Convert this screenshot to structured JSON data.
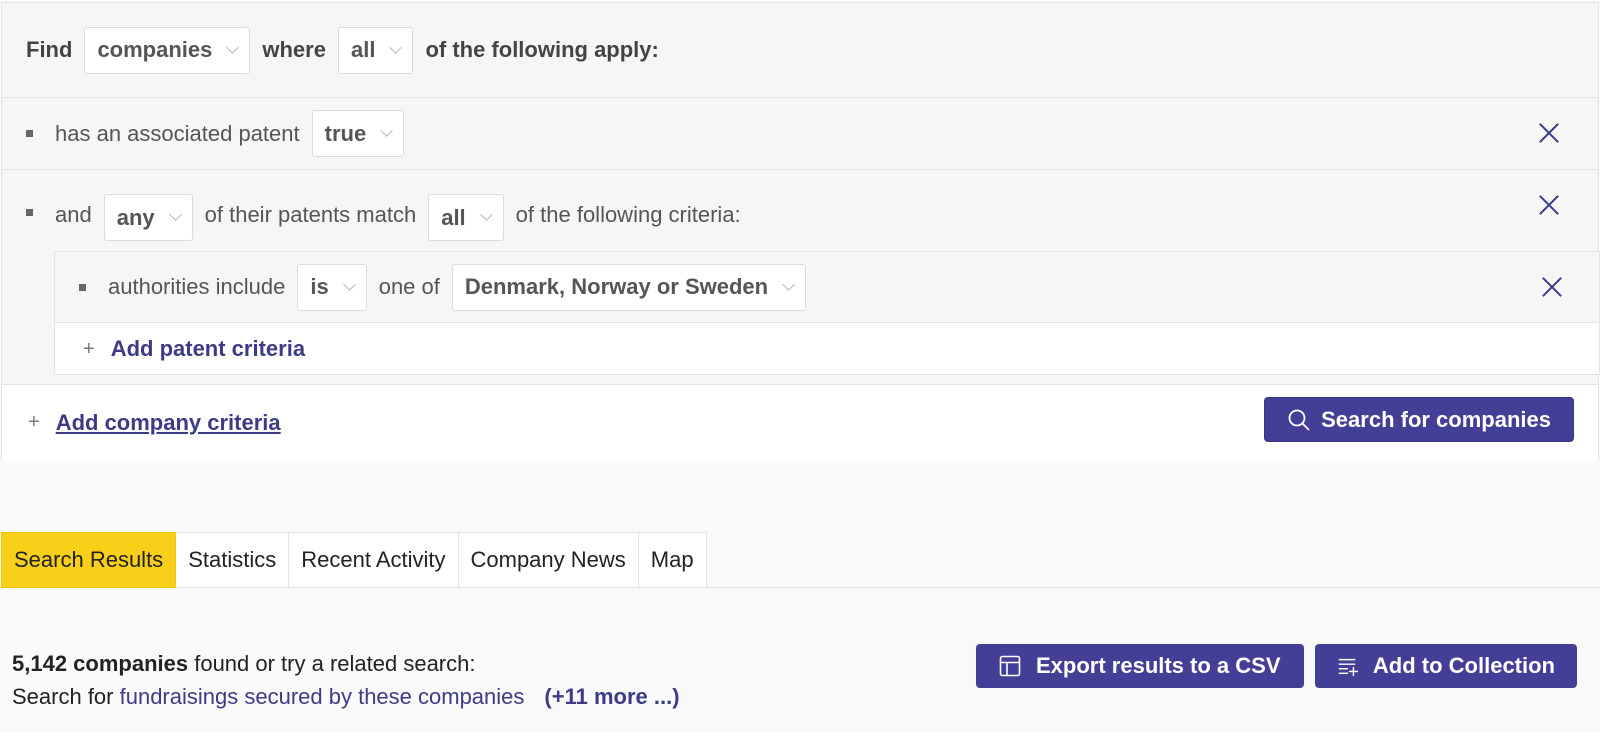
{
  "query": {
    "find_label": "Find",
    "entity_select": "companies",
    "where_label": "where",
    "match_select": "all",
    "apply_text": "of the following apply:"
  },
  "criteria": [
    {
      "label": "has an associated patent",
      "value": "true"
    },
    {
      "and_label": "and",
      "quantifier": "any",
      "middle_text": "of their patents match",
      "match_select": "all",
      "end_text": "of the following criteria:",
      "nested": {
        "label": "authorities include",
        "operator": "is",
        "one_of_label": "one of",
        "values": "Denmark, Norway or Sweden",
        "add_label": "Add patent criteria"
      }
    }
  ],
  "footer": {
    "add_company_label": "Add company criteria",
    "search_button": "Search for companies"
  },
  "tabs": [
    {
      "label": "Search Results",
      "active": true
    },
    {
      "label": "Statistics",
      "active": false
    },
    {
      "label": "Recent Activity",
      "active": false
    },
    {
      "label": "Company News",
      "active": false
    },
    {
      "label": "Map",
      "active": false
    }
  ],
  "results": {
    "count": "5,142 companies",
    "found_text": " found or try a related search:",
    "search_for": "Search for ",
    "related_link": "fundraisings secured by these companies",
    "more_link": "(+11 more ...)",
    "export_button": "Export results to a CSV",
    "collection_button": "Add to Collection"
  },
  "colors": {
    "accent": "#443f96",
    "active_tab": "#f8d019",
    "link": "#3c3b86"
  }
}
